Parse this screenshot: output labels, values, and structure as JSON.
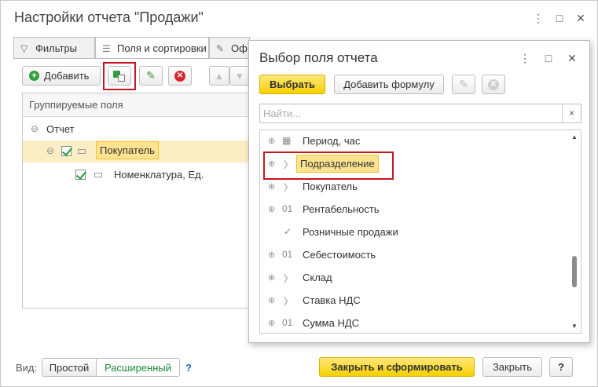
{
  "window": {
    "title": "Настройки отчета \"Продажи\"",
    "controls": [
      "⋮",
      "□",
      "✕"
    ]
  },
  "tabs": [
    {
      "label": "Фильтры",
      "icon": "filter-icon",
      "active": false
    },
    {
      "label": "Поля и сортировки",
      "icon": "fields-icon",
      "active": true
    },
    {
      "label": "Оф",
      "icon": "brush-icon",
      "active": false
    }
  ],
  "toolbar": {
    "add_label": "Добавить"
  },
  "grid": {
    "header": "Группируемые поля",
    "rows": [
      {
        "label": "Отчет",
        "level": 0
      },
      {
        "label": "Покупатель",
        "level": 1,
        "checked": true,
        "selected": true
      },
      {
        "label": "Номенклатура, Ед.",
        "level": 2,
        "checked": true
      }
    ]
  },
  "footer": {
    "view_label": "Вид:",
    "simple": "Простой",
    "extended": "Расширенный",
    "help_link": "?",
    "close_and_build": "Закрыть и сформировать",
    "close": "Закрыть",
    "help": "?"
  },
  "popup": {
    "title": "Выбор поля отчета",
    "select": "Выбрать",
    "add_formula": "Добавить формулу",
    "search_placeholder": "Найти...",
    "clear": "×",
    "items": [
      {
        "label": "Период, час",
        "icon": "calendar-icon",
        "expand": "⊕"
      },
      {
        "label": "Подразделение",
        "icon": "chevron-right-icon",
        "expand": "⊕",
        "selected": true
      },
      {
        "label": "Покупатель",
        "icon": "chevron-right-icon",
        "expand": "⊕"
      },
      {
        "label": "Рентабельность",
        "icon": "numeric-01-icon",
        "expand": "⊕"
      },
      {
        "label": "Розничные продажи",
        "icon": "check-icon",
        "expand": ""
      },
      {
        "label": "Себестоимость",
        "icon": "numeric-01-icon",
        "expand": "⊕"
      },
      {
        "label": "Склад",
        "icon": "chevron-right-icon",
        "expand": "⊕"
      },
      {
        "label": "Ставка НДС",
        "icon": "chevron-right-icon",
        "expand": "⊕"
      },
      {
        "label": "Сумма НДС",
        "icon": "numeric-01-icon",
        "expand": "⊕"
      }
    ]
  },
  "colors": {
    "accent_yellow": "#f5d000",
    "highlight": "#fde28f",
    "annotation_red": "#c8161d",
    "link_green": "#1a8a3a"
  }
}
